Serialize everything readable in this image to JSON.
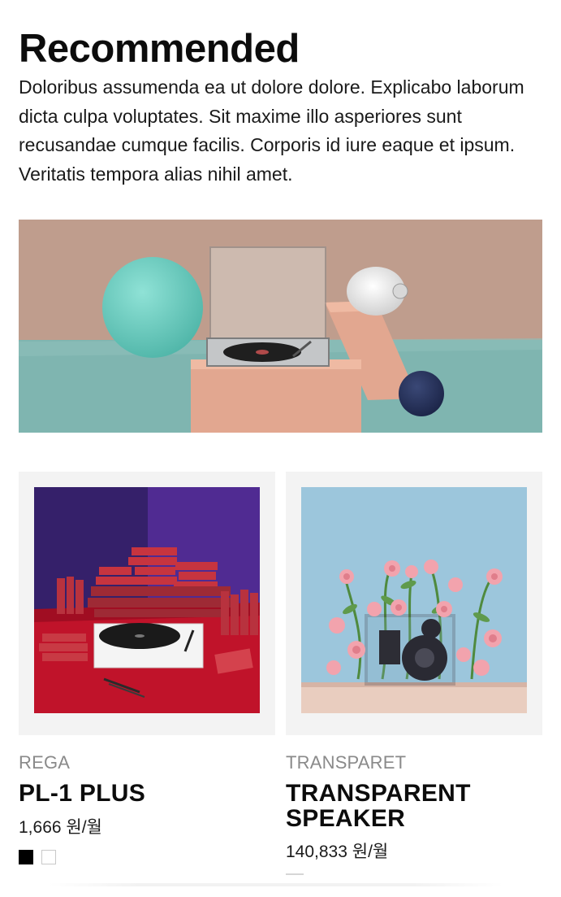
{
  "section": {
    "title": "Recommended",
    "description": "Doloribus assumenda ea ut dolore dolore. Explicabo laborum dicta culpa voluptates. Sit maxime illo asperiores sunt recusandae cumque facilis. Corporis id iure eaque et ipsum. Veritatis tempora alias nihil amet."
  },
  "products": [
    {
      "brand": "REGA",
      "name": "PL-1 PLUS",
      "price": "1,666 원/월",
      "swatches": [
        "black",
        "white"
      ]
    },
    {
      "brand": "TRANSPARET",
      "name": "TRANSPARENT SPEAKER",
      "price": "140,833 원/월",
      "swatches": []
    }
  ],
  "colors": {
    "text": "#111111",
    "muted": "#8a8a8a",
    "card_bg": "#f3f3f3"
  }
}
